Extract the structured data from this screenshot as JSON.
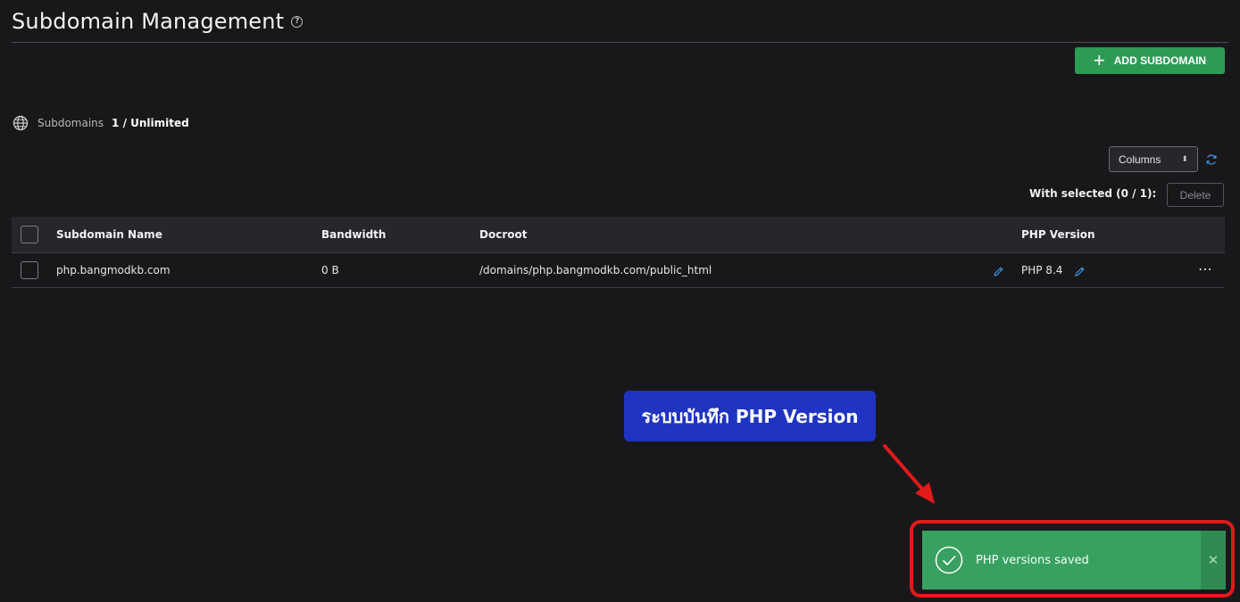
{
  "header": {
    "title": "Subdomain Management",
    "help_icon": "question-circle-icon"
  },
  "toolbar": {
    "add_label": "ADD SUBDOMAIN",
    "add_icon": "plus-icon",
    "columns_label": "Columns",
    "with_selected": "With selected (0 / 1):",
    "delete_label": "Delete"
  },
  "summary": {
    "label": "Subdomains",
    "value": "1 / Unlimited",
    "icon": "globe-icon"
  },
  "table": {
    "headers": {
      "name": "Subdomain Name",
      "bandwidth": "Bandwidth",
      "docroot": "Docroot",
      "php": "PHP Version"
    },
    "rows": [
      {
        "name": "php.bangmodkb.com",
        "bandwidth": "0 B",
        "docroot": "/domains/php.bangmodkb.com/public_html",
        "php": "PHP 8.4"
      }
    ]
  },
  "annotation": {
    "callout": "ระบบบันทึก PHP  Version"
  },
  "toast": {
    "message": "PHP versions saved",
    "close": "✕"
  },
  "colors": {
    "accent_green": "#2e9b55",
    "toast_green": "#38a060",
    "callout_blue": "#1f34c0",
    "highlight_red": "#e21a1a",
    "link_blue": "#3b8fd9"
  }
}
